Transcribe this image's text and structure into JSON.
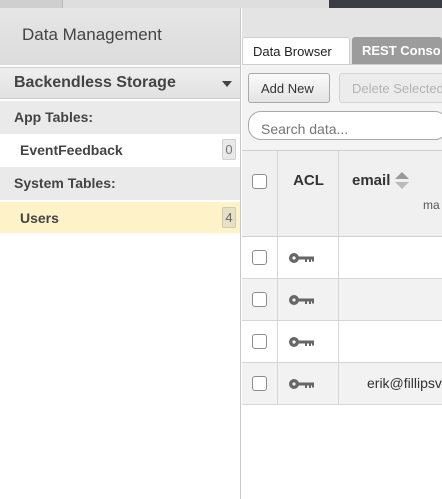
{
  "app": {
    "section_title": "Data Management"
  },
  "sidebar": {
    "storage_label": "Backendless Storage",
    "app_tables_label": "App Tables:",
    "app_tables": [
      {
        "name": "EventFeedback",
        "count": "0"
      }
    ],
    "system_tables_label": "System Tables:",
    "system_tables": [
      {
        "name": "Users",
        "count": "4",
        "selected": true
      }
    ]
  },
  "tabs": {
    "data_browser": "Data Browser",
    "rest_console": "REST Conso"
  },
  "toolbar": {
    "add_new": "Add New",
    "delete_selected": "Delete Selected",
    "search_placeholder": "Search data..."
  },
  "grid": {
    "columns": {
      "acl": "ACL",
      "email": "email",
      "email_sub": "ma"
    },
    "rows": [
      {
        "email": ""
      },
      {
        "email": ""
      },
      {
        "email": ""
      },
      {
        "email": "erik@fillipsv"
      }
    ]
  },
  "colors": {
    "selected_row": "#fdf2c8",
    "inactive_tab": "#9c9c9c",
    "top_dark": "#3a3d45"
  },
  "icons": {
    "row_acl": "key-icon",
    "sidebar_toggle": "chevron-down-icon",
    "sort": "sort-icon"
  }
}
